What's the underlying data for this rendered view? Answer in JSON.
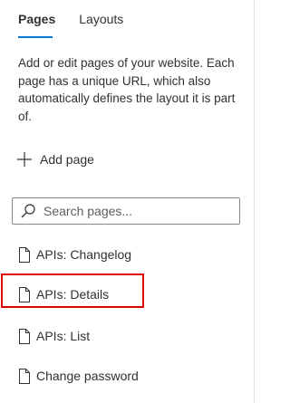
{
  "tabs": {
    "pages": "Pages",
    "layouts": "Layouts"
  },
  "description": "Add or edit pages of your website. Each page has a unique URL, which also automatically defines the layout it is part of.",
  "add_page": {
    "label": "Add page",
    "icon": "plus-icon"
  },
  "search": {
    "placeholder": "Search pages...",
    "value": "",
    "icon": "search-icon"
  },
  "pages": [
    {
      "label": "APIs: Changelog",
      "icon": "page-icon"
    },
    {
      "label": "APIs: Details",
      "icon": "page-icon"
    },
    {
      "label": "APIs: List",
      "icon": "page-icon"
    },
    {
      "label": "Change password",
      "icon": "page-icon"
    }
  ],
  "colors": {
    "accent": "#0078d4",
    "highlight": "#e00000",
    "text": "#323130"
  }
}
